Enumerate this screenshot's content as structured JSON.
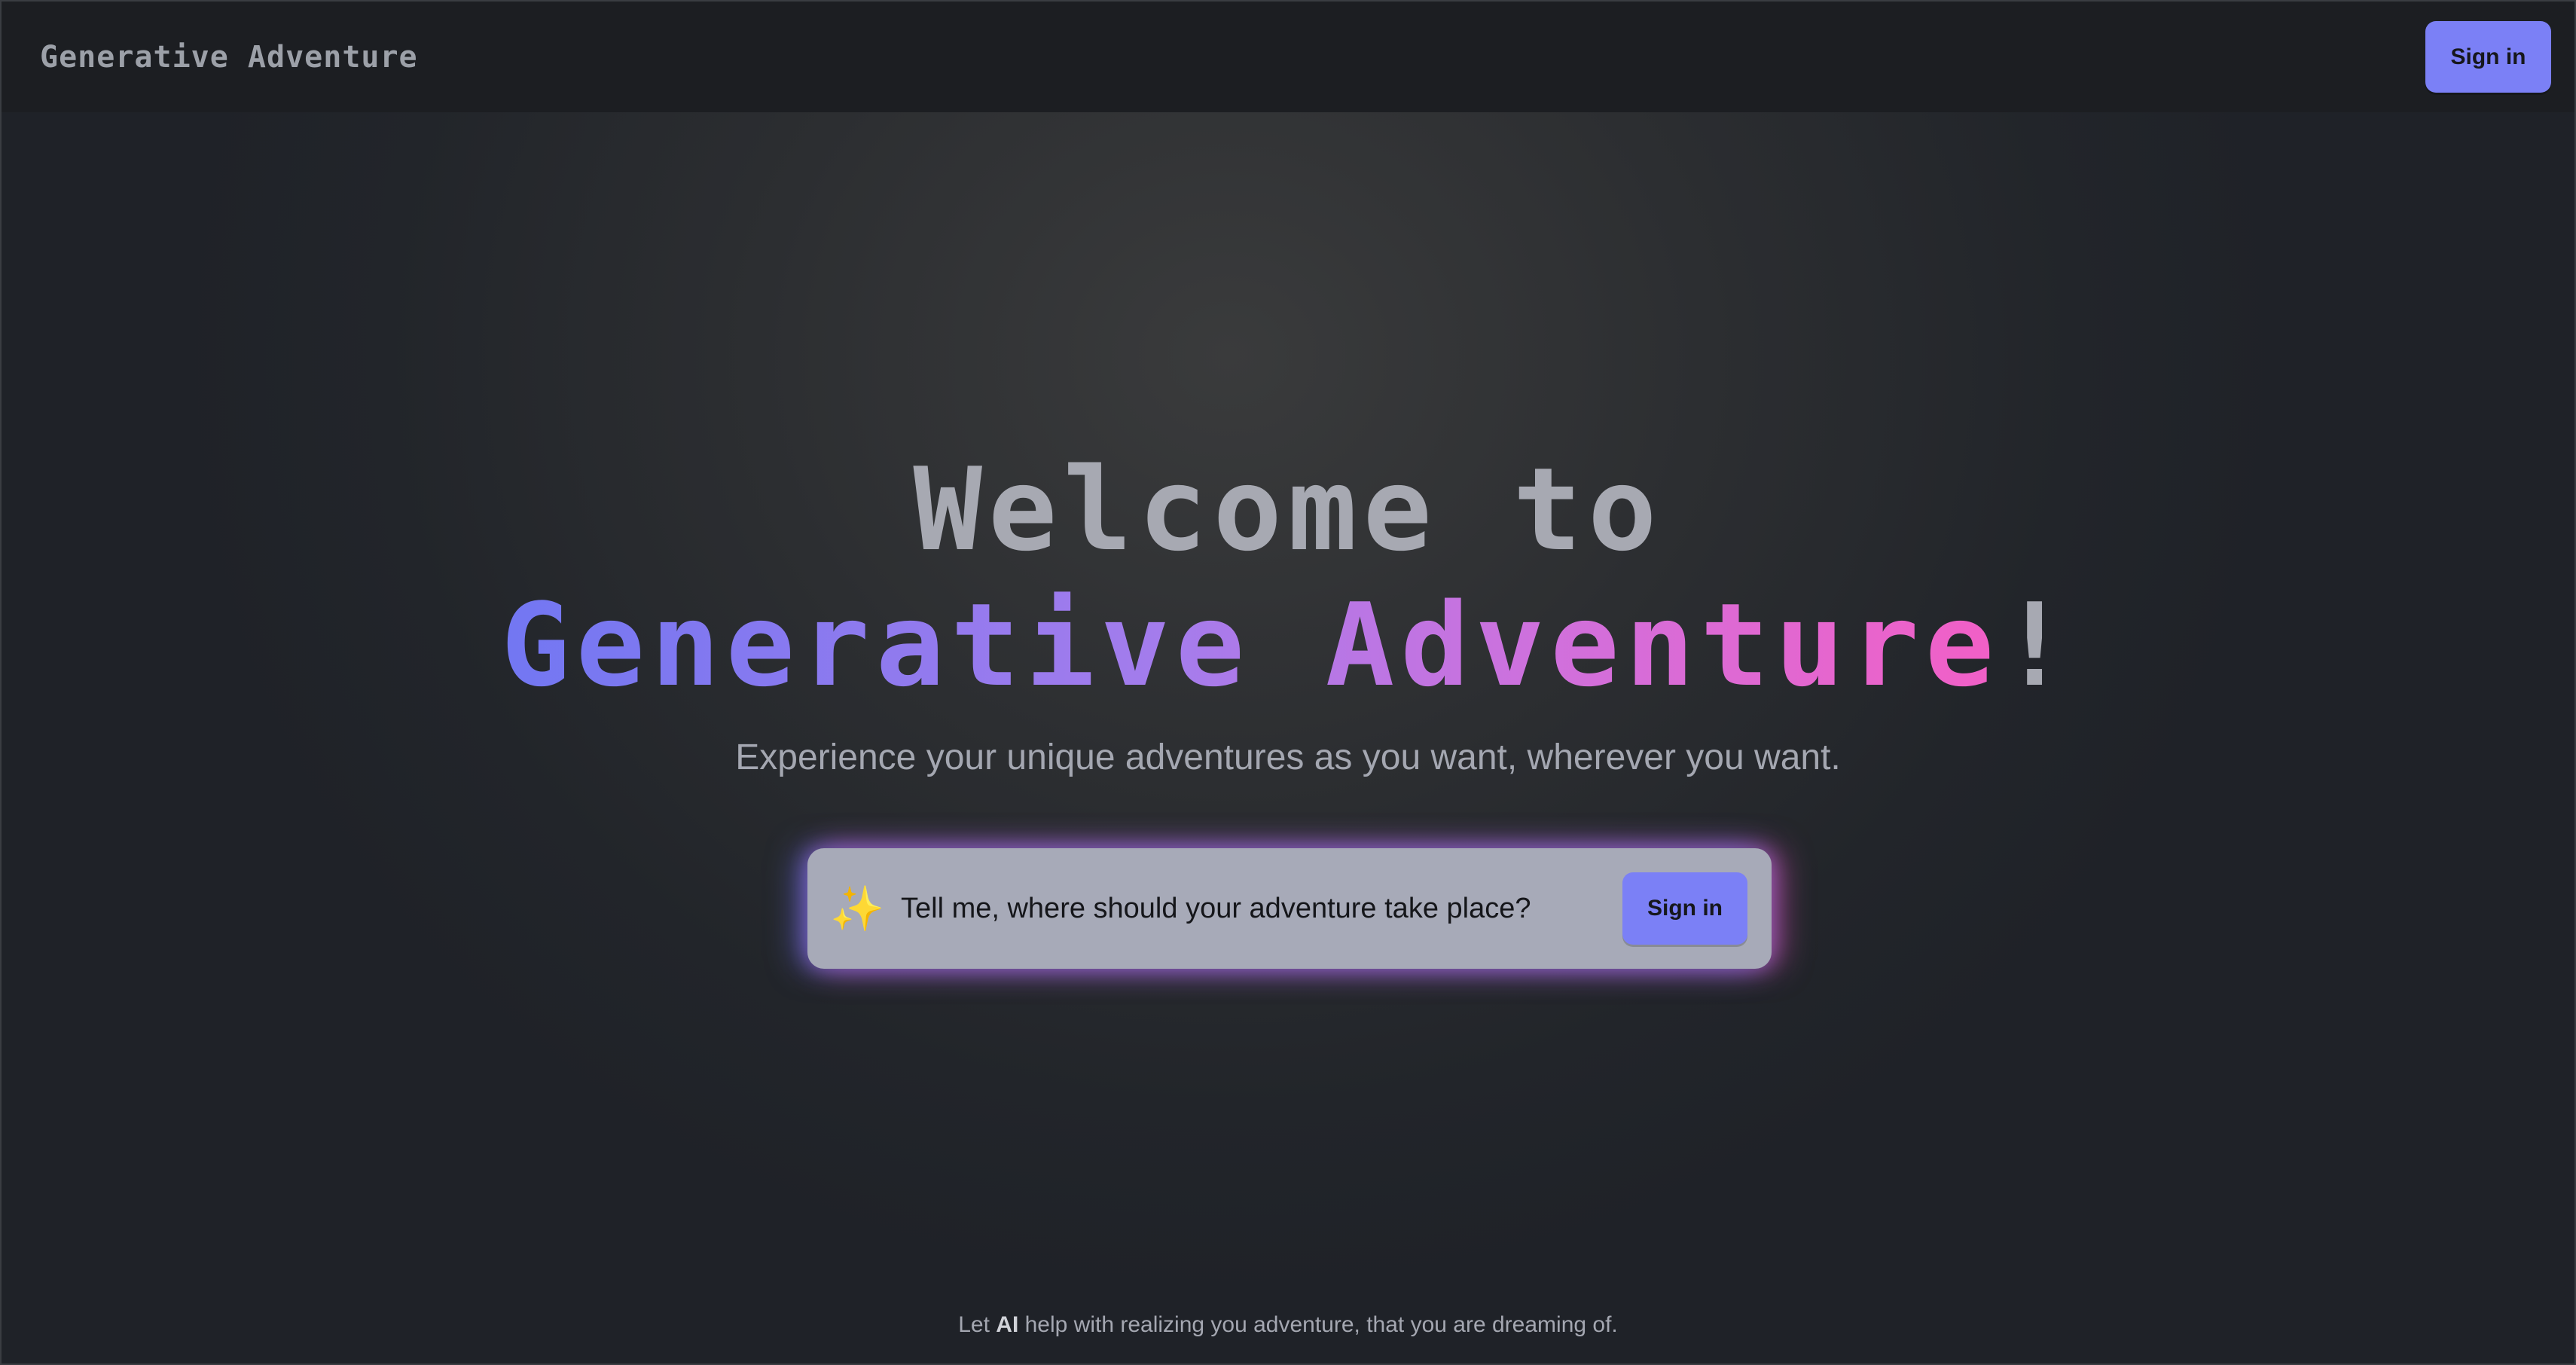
{
  "topbar": {
    "brand": "Generative Adventure",
    "sign_in_label": "Sign in"
  },
  "hero": {
    "welcome": "Welcome to",
    "title": "Generative Adventure",
    "title_suffix": "!",
    "tagline": "Experience your unique adventures as you want, wherever you want."
  },
  "prompt": {
    "icon": "sparkles-icon",
    "placeholder": "Tell me, where should your adventure take place?",
    "button_label": "Sign in"
  },
  "footer": {
    "prefix": "Let ",
    "highlight": "AI",
    "suffix": " help with realizing you adventure, that you are dreaming of."
  },
  "colors": {
    "accent": "#7b80f6",
    "gradient_start": "#7277f2",
    "gradient_end": "#f25fc6",
    "background": "#1f2228"
  }
}
